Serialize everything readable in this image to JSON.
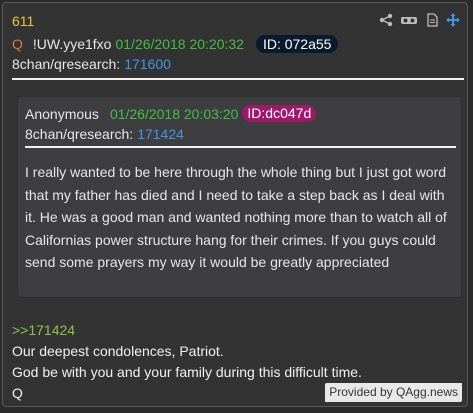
{
  "post": {
    "number": "611",
    "q_marker": "Q",
    "tripcode": "!UW.yye1fxo",
    "timestamp": "01/26/2018 20:20:32",
    "id_badge": "ID: 072a55",
    "board": "8chan/qresearch:",
    "board_ref": "171600"
  },
  "toolbar": {
    "icons": [
      "share-icon",
      "glasses-icon",
      "document-icon",
      "move-icon"
    ]
  },
  "quoted": {
    "author": "Anonymous",
    "timestamp": "01/26/2018 20:03:20",
    "id_badge": "ID:dc047d",
    "board": "8chan/qresearch:",
    "board_ref": "171424",
    "body": "I really wanted to be here through the whole thing but I just got word that my father has died and I need to take a step back as I deal with it. He was a good man and wanted nothing more than to watch all of Californias power structure hang for their crimes. If you guys could send some prayers my way it would be greatly appreciated"
  },
  "reply": {
    "ref": ">>171424",
    "lines": [
      "Our deepest condolences, Patriot.",
      "God be with you and your family during this difficult time.",
      "Q"
    ]
  },
  "footer": {
    "provided_by": "Provided by QAgg.news"
  },
  "colors": {
    "post_number": "#e5c63a",
    "timestamp": "#40c040",
    "link": "#3f95e8",
    "reply_ref": "#8bc34a",
    "quoted_id_badge": "#a0176b",
    "main_id_badge": "#0a1a2e"
  }
}
